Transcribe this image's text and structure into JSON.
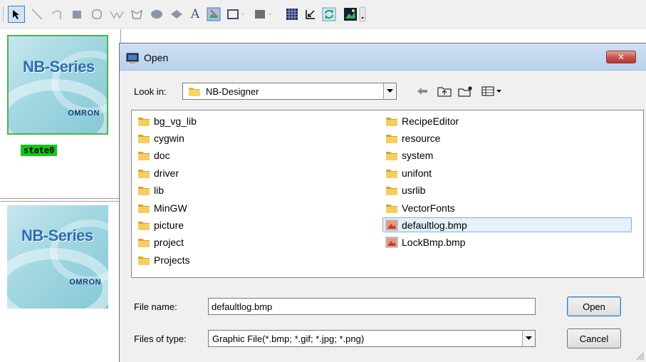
{
  "toolbar": {
    "tools": [
      {
        "name": "select-arrow-icon"
      },
      {
        "name": "line-icon"
      },
      {
        "name": "arc-icon"
      },
      {
        "name": "rectangle-icon"
      },
      {
        "name": "rounded-rectangle-icon"
      },
      {
        "name": "polyline-icon"
      },
      {
        "name": "polygon-icon"
      },
      {
        "name": "ellipse-icon"
      },
      {
        "name": "diamond-icon"
      },
      {
        "name": "text-tool-icon"
      },
      {
        "name": "picture-tool-icon"
      },
      {
        "name": "frame-color-icon"
      },
      {
        "name": "fill-color-icon"
      },
      {
        "name": "grid-icon"
      },
      {
        "name": "align-icon"
      },
      {
        "name": "refresh-icon"
      },
      {
        "name": "image-icon"
      }
    ],
    "text_tool_glyph": "A"
  },
  "left_panel": {
    "thumbnail_title": "NB-Series",
    "thumbnail_brand": "OMRON",
    "state_label": "state0"
  },
  "dialog": {
    "title": "Open",
    "close_glyph": "✕",
    "look_in_label": "Look in:",
    "look_in_value": "NB-Designer",
    "folders_col1": [
      "bg_vg_lib",
      "cygwin",
      "doc",
      "driver",
      "lib",
      "MinGW",
      "picture",
      "project",
      "Projects"
    ],
    "folders_col2": [
      "RecipeEditor",
      "resource",
      "system",
      "unifont",
      "usrlib",
      "VectorFonts"
    ],
    "files_col2": [
      "defaultlog.bmp",
      "LockBmp.bmp"
    ],
    "selected_file": "defaultlog.bmp",
    "file_name_label": "File name:",
    "file_name_value": "defaultlog.bmp",
    "files_of_type_label": "Files of type:",
    "files_of_type_value": "Graphic File(*.bmp; *.gif; *.jpg; *.png)",
    "open_button": "Open",
    "cancel_button": "Cancel"
  },
  "colors": {
    "state_highlight": "#11c811",
    "close_button": "#c75050",
    "folder": "#e8b63f",
    "selection": "#e5f1fb"
  }
}
